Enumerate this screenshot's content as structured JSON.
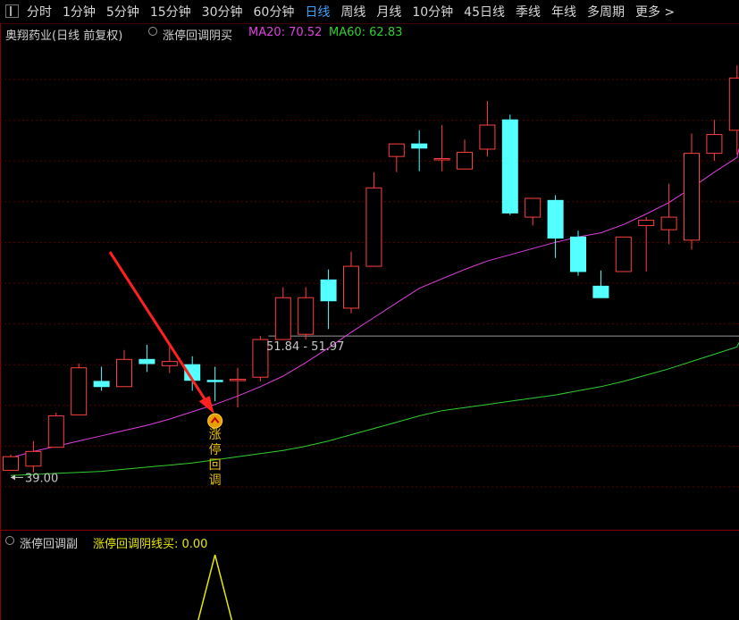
{
  "toolbar": {
    "timeframes": [
      "分时",
      "1分钟",
      "5分钟",
      "15分钟",
      "30分钟",
      "60分钟",
      "日线",
      "周线",
      "月线",
      "10分钟",
      "45日线",
      "季线",
      "年线",
      "多周期",
      "更多 >"
    ],
    "active": "日线"
  },
  "header": {
    "stock": "奥翔药业(日线 前复权)",
    "indicator_name": "涨停回调阴买",
    "ma20_label": "MA20: 70.52",
    "ma60_label": "MA60: 62.83",
    "ma20_color": "#e040e0",
    "ma60_color": "#30d030"
  },
  "sub_header": {
    "indicator_name": "涨停回调副",
    "value_label": "涨停回调阴线买: 0.00"
  },
  "annotations": {
    "price_line_label": "51.84 - 51.97",
    "low_label": "39.00",
    "signal_text": [
      "涨",
      "停",
      "回",
      "调"
    ]
  },
  "chart_data": {
    "type": "candlestick",
    "title": "奥翔药业(日线 前复权)",
    "candles": [
      {
        "o": 39.0,
        "h": 40.5,
        "l": 39.0,
        "c": 40.3
      },
      {
        "o": 39.4,
        "h": 41.8,
        "l": 38.8,
        "c": 40.8
      },
      {
        "o": 41.2,
        "h": 44.5,
        "l": 41.2,
        "c": 44.2
      },
      {
        "o": 44.3,
        "h": 49.2,
        "l": 44.3,
        "c": 48.8
      },
      {
        "o": 47.5,
        "h": 48.9,
        "l": 46.6,
        "c": 47.0
      },
      {
        "o": 47.0,
        "h": 50.5,
        "l": 47.0,
        "c": 49.6
      },
      {
        "o": 49.6,
        "h": 51.0,
        "l": 48.4,
        "c": 49.2
      },
      {
        "o": 49.0,
        "h": 50.8,
        "l": 48.3,
        "c": 49.4
      },
      {
        "o": 49.1,
        "h": 49.9,
        "l": 46.6,
        "c": 47.6
      },
      {
        "o": 47.6,
        "h": 48.9,
        "l": 45.6,
        "c": 47.5
      },
      {
        "o": 47.6,
        "h": 48.8,
        "l": 45.0,
        "c": 47.7
      },
      {
        "o": 47.9,
        "h": 51.84,
        "l": 47.5,
        "c": 51.5
      },
      {
        "o": 51.5,
        "h": 56.5,
        "l": 51.5,
        "c": 55.5
      },
      {
        "o": 52.0,
        "h": 56.5,
        "l": 51.5,
        "c": 55.5
      },
      {
        "o": 57.2,
        "h": 58.2,
        "l": 52.5,
        "c": 55.2
      },
      {
        "o": 54.5,
        "h": 59.9,
        "l": 54.0,
        "c": 58.5
      },
      {
        "o": 58.5,
        "h": 67.5,
        "l": 58.5,
        "c": 66.0
      },
      {
        "o": 69.0,
        "h": 70.0,
        "l": 67.5,
        "c": 70.2
      },
      {
        "o": 70.2,
        "h": 71.5,
        "l": 67.6,
        "c": 69.8
      },
      {
        "o": 68.8,
        "h": 72.0,
        "l": 67.6,
        "c": 68.8
      },
      {
        "o": 67.8,
        "h": 70.6,
        "l": 67.8,
        "c": 69.4
      },
      {
        "o": 69.7,
        "h": 74.3,
        "l": 69.0,
        "c": 72.0
      },
      {
        "o": 72.5,
        "h": 73.0,
        "l": 63.4,
        "c": 63.6
      },
      {
        "o": 63.2,
        "h": 65.0,
        "l": 62.4,
        "c": 65.0
      },
      {
        "o": 64.8,
        "h": 65.3,
        "l": 59.3,
        "c": 61.2
      },
      {
        "o": 61.3,
        "h": 61.9,
        "l": 57.6,
        "c": 58.0
      },
      {
        "o": 56.6,
        "h": 58.1,
        "l": 55.5,
        "c": 55.5
      },
      {
        "o": 58.0,
        "h": 61.3,
        "l": 58.0,
        "c": 61.3
      },
      {
        "o": 62.4,
        "h": 63.2,
        "l": 58.0,
        "c": 62.9
      },
      {
        "o": 62.0,
        "h": 66.4,
        "l": 60.6,
        "c": 63.2
      },
      {
        "o": 61.0,
        "h": 71.2,
        "l": 60.1,
        "c": 69.3
      },
      {
        "o": 69.3,
        "h": 72.5,
        "l": 68.6,
        "c": 71.1
      },
      {
        "o": 71.5,
        "h": 77.7,
        "l": 69.2,
        "c": 76.5
      }
    ],
    "series": [
      {
        "name": "MA20",
        "values": [
          40.2,
          40.8,
          41.3,
          41.8,
          42.3,
          42.8,
          43.3,
          43.9,
          44.6,
          45.3,
          46.1,
          47.0,
          48.0,
          49.3,
          50.7,
          52.2,
          53.6,
          55.0,
          56.4,
          57.3,
          58.2,
          59.0,
          59.6,
          60.2,
          60.8,
          61.3,
          61.7,
          62.5,
          63.5,
          64.6,
          66.0,
          67.5,
          68.9
        ]
      },
      {
        "name": "MA60",
        "values": [
          38.5,
          38.6,
          38.7,
          38.8,
          38.9,
          39.1,
          39.3,
          39.5,
          39.7,
          40.0,
          40.3,
          40.6,
          40.9,
          41.3,
          41.8,
          42.4,
          43.0,
          43.6,
          44.2,
          44.7,
          45.0,
          45.3,
          45.6,
          45.9,
          46.2,
          46.6,
          47.0,
          47.5,
          48.1,
          48.7,
          49.4,
          50.1,
          50.8
        ]
      }
    ],
    "signal_index": 9,
    "price_line": {
      "value": 51.84,
      "from_index": 11
    },
    "ylim": [
      33.4,
      80.2
    ]
  },
  "sub_chart_data": {
    "type": "line",
    "name": "涨停回调阴线买",
    "values": [
      0,
      0,
      0,
      0,
      0,
      0,
      0,
      0,
      0,
      1,
      0,
      0,
      0,
      0,
      0,
      0,
      0,
      0,
      0,
      0,
      0,
      0,
      0,
      0,
      0,
      0,
      0,
      0,
      0,
      0,
      0,
      0,
      0
    ],
    "color": "#e8e800"
  }
}
